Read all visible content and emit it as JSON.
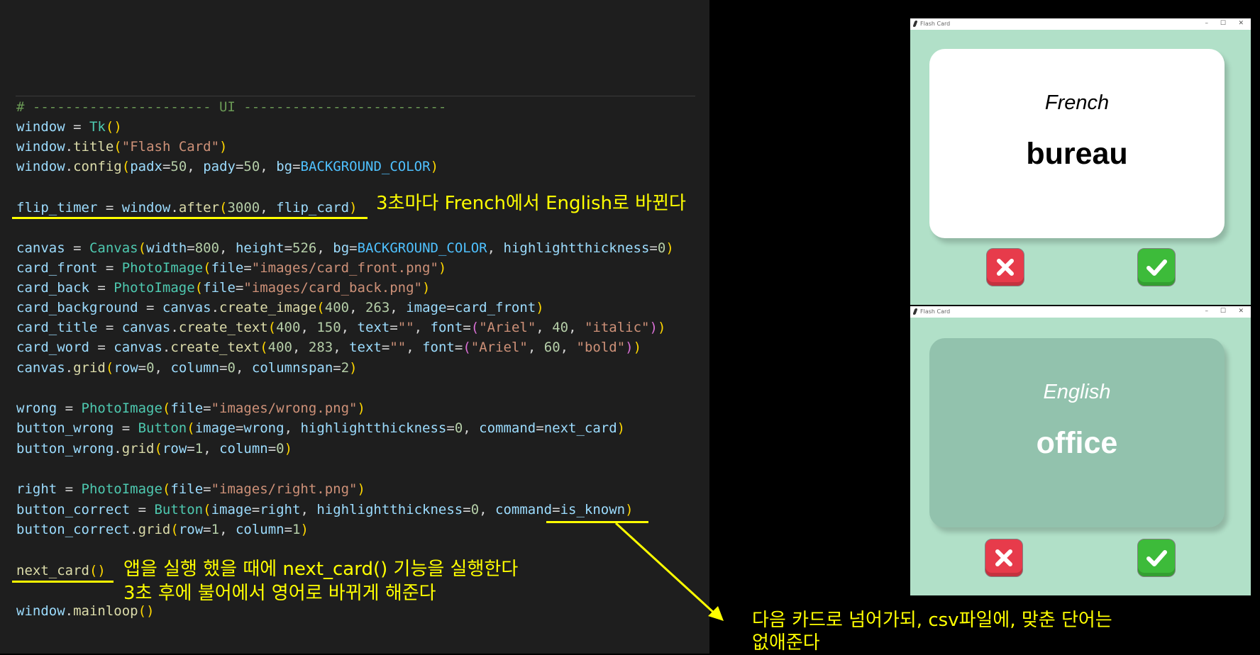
{
  "code": {
    "comment": "# ---------------------- UI -------------------------",
    "lines": {
      "window_tk": "window = Tk()",
      "window_title": "window.title(\"Flash Card\")",
      "window_config": "window.config(padx=50, pady=50, bg=BACKGROUND_COLOR)",
      "flip_timer": "flip_timer = window.after(3000, flip_card)",
      "canvas": "canvas = Canvas(width=800, height=526, bg=BACKGROUND_COLOR, highlightthickness=0)",
      "card_front": "card_front = PhotoImage(file=\"images/card_front.png\")",
      "card_back": "card_back = PhotoImage(file=\"images/card_back.png\")",
      "card_background": "card_background = canvas.create_image(400, 263, image=card_front)",
      "card_title": "card_title = canvas.create_text(400, 150, text=\"\", font=(\"Ariel\", 40, \"italic\"))",
      "card_word": "card_word = canvas.create_text(400, 283, text=\"\", font=(\"Ariel\", 60, \"bold\"))",
      "canvas_grid": "canvas.grid(row=0, column=0, columnspan=2)",
      "wrong": "wrong = PhotoImage(file=\"images/wrong.png\")",
      "button_wrong": "button_wrong = Button(image=wrong, highlightthickness=0, command=next_card)",
      "button_wrong_grid": "button_wrong.grid(row=1, column=0)",
      "right": "right = PhotoImage(file=\"images/right.png\")",
      "button_correct": "button_correct = Button(image=right, highlightthickness=0, command=is_known)",
      "button_correct_grid": "button_correct.grid(row=1, column=1)",
      "next_card_call": "next_card()",
      "mainloop": "window.mainloop()"
    }
  },
  "annotations": {
    "flip_timer_note": "3초마다 French에서 English로 바뀐다",
    "next_card_note_1": "앱을 실행 했을 때에 next_card() 기능을 실행한다",
    "next_card_note_2": "3초 후에 불어에서 영어로 바뀌게 해준다",
    "is_known_note_1": "다음 카드로 넘어가되, csv파일에, 맞춘 단어는",
    "is_known_note_2": "없애준다"
  },
  "app_windows": [
    {
      "title": "Flash Card",
      "controls": {
        "minimize": "–",
        "maximize": "☐",
        "close": "✕"
      },
      "card_side": "front",
      "card_title": "French",
      "card_word": "bureau"
    },
    {
      "title": "Flash Card",
      "controls": {
        "minimize": "–",
        "maximize": "☐",
        "close": "✕"
      },
      "card_side": "back",
      "card_title": "English",
      "card_word": "office"
    }
  ],
  "colors": {
    "editor_background": "#1e1e1e",
    "annotation": "#ffff00",
    "app_background": "#b1e0c8",
    "card_front": "#ffffff",
    "card_back": "#92c2ad",
    "wrong_button": "#e73b4b",
    "right_button": "#3dbb3a"
  }
}
